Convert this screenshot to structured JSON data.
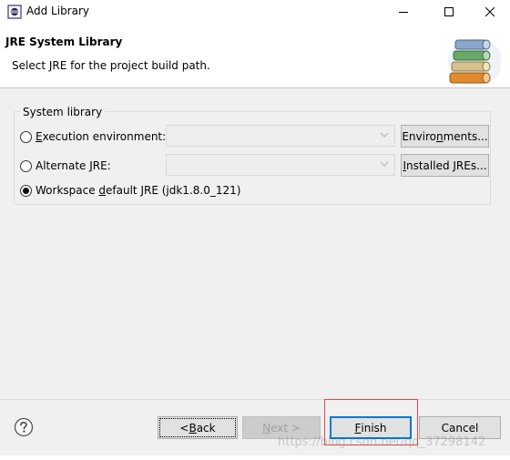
{
  "window": {
    "title": "Add Library"
  },
  "header": {
    "title": "JRE System Library",
    "description": "Select JRE for the project build path."
  },
  "group": {
    "legend": "System library",
    "options": [
      {
        "label_prefix": "",
        "mnemonic": "E",
        "label_rest": "xecution environment:",
        "selected": false
      },
      {
        "label_prefix": "Alternate ",
        "mnemonic": "J",
        "label_rest": "RE:",
        "selected": false
      },
      {
        "label_prefix": "Workspace ",
        "mnemonic": "d",
        "label_rest": "efault JRE (jdk1.8.0_121)",
        "selected": true
      }
    ],
    "environments_button": {
      "prefix": "Enviro",
      "mnemonic": "n",
      "rest": "ments..."
    },
    "installed_button": {
      "prefix": "",
      "mnemonic": "I",
      "rest": "nstalled JREs..."
    }
  },
  "footer": {
    "back": {
      "prefix": "< ",
      "mnemonic": "B",
      "rest": "ack"
    },
    "next": {
      "prefix": "",
      "mnemonic": "N",
      "rest": "ext >"
    },
    "finish": {
      "prefix": "",
      "mnemonic": "F",
      "rest": "inish"
    },
    "cancel": "Cancel"
  },
  "watermark": "https://blog.csdn.net/qq_37298142",
  "colors": {
    "accent": "#0078d7",
    "highlight": "#e04545",
    "background": "#f0f0f0"
  }
}
